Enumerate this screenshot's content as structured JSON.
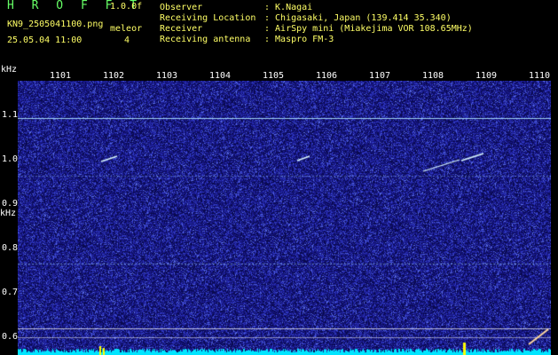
{
  "header": {
    "title": "H R O F F T",
    "version": "1.0.0f",
    "filename": "KN9_2505041100.png",
    "algorithm": "meleor",
    "datetime": "25.05.04 11:00",
    "count": "4"
  },
  "info": [
    {
      "label": "Observer",
      "value": ": K.Nagai"
    },
    {
      "label": "Receiving Location",
      "value": ": Chigasaki, Japan (139.414 35.340)"
    },
    {
      "label": "Receiver",
      "value": ": AirSpy mini (Miakejima VOR 108.65MHz)"
    },
    {
      "label": "Receiving antenna",
      "value": ": Maspro FM-3"
    }
  ],
  "axis": {
    "x_unit": "kHz",
    "y_unit_label": "kHz",
    "x_ticks": [
      "1101",
      "1102",
      "1103",
      "1104",
      "1105",
      "1106",
      "1107",
      "1108",
      "1109",
      "1110"
    ],
    "y_ticks": [
      "1.1",
      "1.0",
      "0.9",
      "0.8",
      "0.7",
      "0.6"
    ]
  },
  "colors": {
    "background": "#1a1a8c",
    "noise_low": "#0b0b5a",
    "noise_high": "#3a46d0",
    "signal": "#aee6ff",
    "meteor": "#d9f7ff",
    "bottom_bar": "#00e5ff",
    "header_yellow": "#ffff66",
    "header_green": "#66ff66"
  }
}
